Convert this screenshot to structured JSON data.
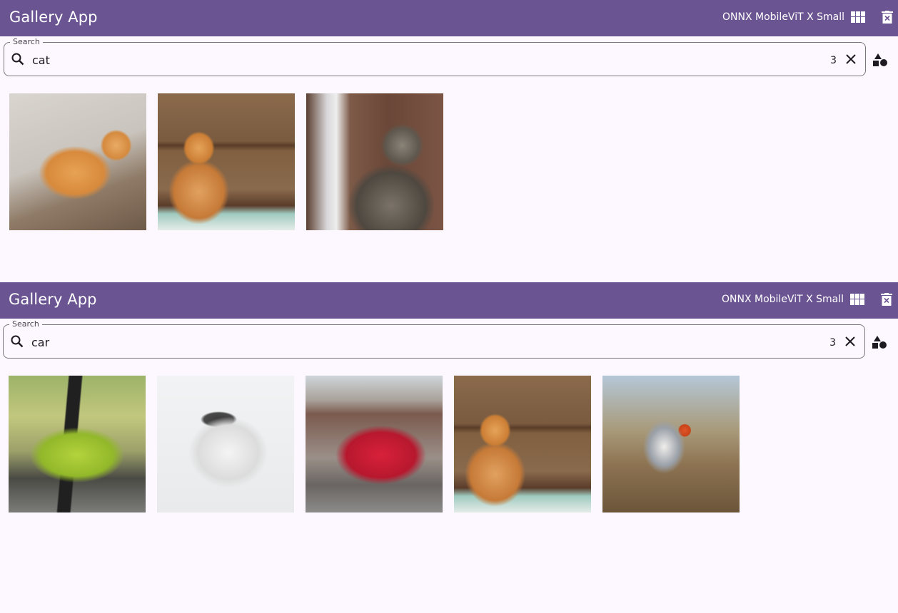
{
  "panels": [
    {
      "app_title": "Gallery App",
      "model_name": "ONNX MobileViT X Small",
      "search": {
        "label": "Search",
        "value": "cat",
        "result_count": "3"
      },
      "results": [
        {
          "icon": "cat-lying-image"
        },
        {
          "icon": "cat-sitting-image"
        },
        {
          "icon": "cat-tabby-image"
        }
      ]
    },
    {
      "app_title": "Gallery App",
      "model_name": "ONNX MobileViT X Small",
      "search": {
        "label": "Search",
        "value": "car",
        "result_count": "3"
      },
      "results": [
        {
          "icon": "car-green-image"
        },
        {
          "icon": "car-white-image"
        },
        {
          "icon": "car-red-image"
        },
        {
          "icon": "cat-sitting-image"
        },
        {
          "icon": "dog-image"
        }
      ]
    }
  ],
  "colors": {
    "appbar": "#6a5492",
    "background": "#fdf7ff",
    "outline": "#7a7580"
  },
  "icons": {
    "grid": "grid-view-icon",
    "delete": "delete-icon",
    "search": "search-icon",
    "clear": "close-icon",
    "shapes": "category-shapes-icon"
  }
}
